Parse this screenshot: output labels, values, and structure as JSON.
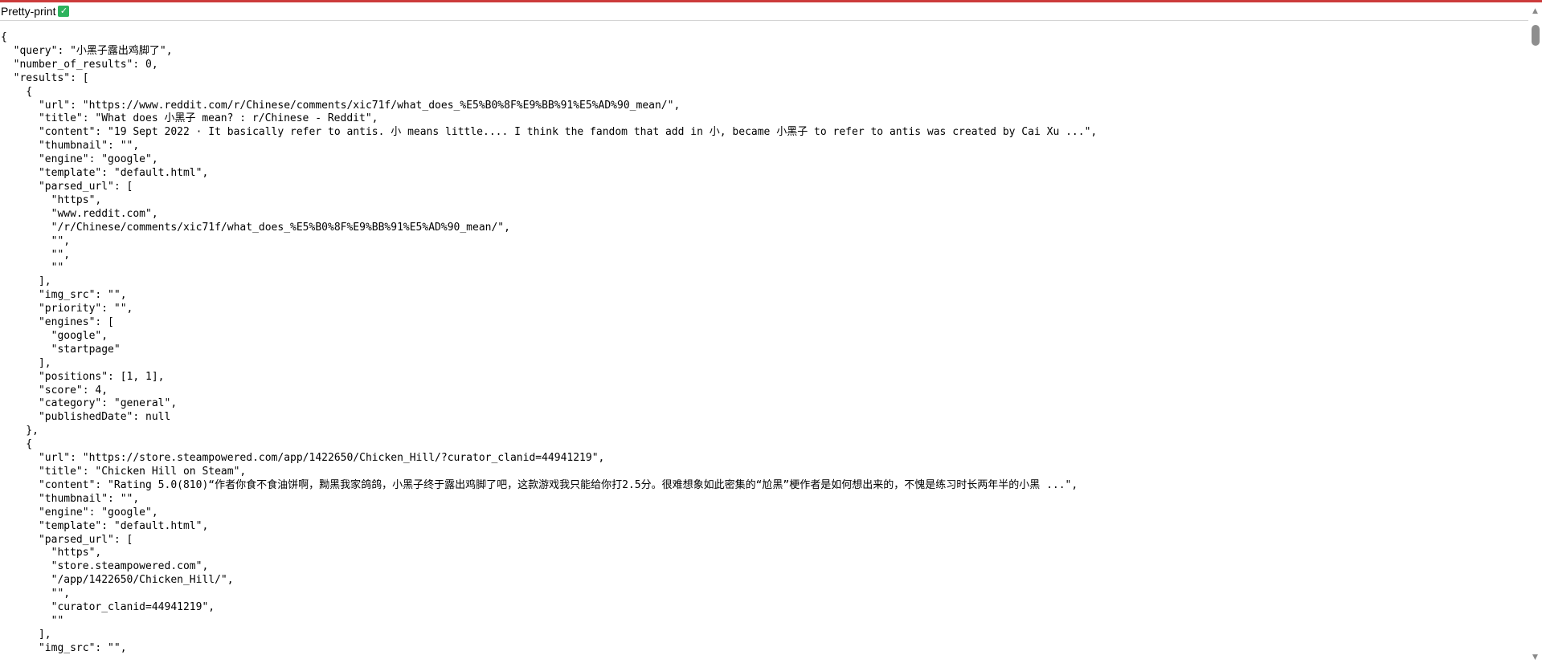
{
  "toolbar": {
    "pretty_print_label": "Pretty-print",
    "pretty_print_icon": "checkbox-checked-icon",
    "pretty_print_checked": true,
    "check_glyph": "✓"
  },
  "scrollbar": {
    "up_glyph": "▲",
    "down_glyph": "▼"
  },
  "json_lines": [
    "{",
    "  \"query\": \"小黑子露出鸡脚了\",",
    "  \"number_of_results\": 0,",
    "  \"results\": [",
    "    {",
    "      \"url\": \"https://www.reddit.com/r/Chinese/comments/xic71f/what_does_%E5%B0%8F%E9%BB%91%E5%AD%90_mean/\",",
    "      \"title\": \"What does 小黑子 mean? : r/Chinese - Reddit\",",
    "      \"content\": \"19 Sept 2022 · It basically refer to antis. 小 means little.... I think the fandom that add in 小, became 小黑子 to refer to antis was created by Cai Xu ...\",",
    "      \"thumbnail\": \"\",",
    "      \"engine\": \"google\",",
    "      \"template\": \"default.html\",",
    "      \"parsed_url\": [",
    "        \"https\",",
    "        \"www.reddit.com\",",
    "        \"/r/Chinese/comments/xic71f/what_does_%E5%B0%8F%E9%BB%91%E5%AD%90_mean/\",",
    "        \"\",",
    "        \"\",",
    "        \"\"",
    "      ],",
    "      \"img_src\": \"\",",
    "      \"priority\": \"\",",
    "      \"engines\": [",
    "        \"google\",",
    "        \"startpage\"",
    "      ],",
    "      \"positions\": [1, 1],",
    "      \"score\": 4,",
    "      \"category\": \"general\",",
    "      \"publishedDate\": null",
    "    },",
    "    {",
    "      \"url\": \"https://store.steampowered.com/app/1422650/Chicken_Hill/?curator_clanid=44941219\",",
    "      \"title\": \"Chicken Hill on Steam\",",
    "      \"content\": \"Rating 5.0(810)“作者你食不食油饼啊，黝黑我家鸽鸽，小黑子终于露出鸡脚了吧，这款游戏我只能给你打2.5分。很难想象如此密集的“尬黑”梗作者是如何想出来的，不愧是练习时长两年半的小黑 ...\",",
    "      \"thumbnail\": \"\",",
    "      \"engine\": \"google\",",
    "      \"template\": \"default.html\",",
    "      \"parsed_url\": [",
    "        \"https\",",
    "        \"store.steampowered.com\",",
    "        \"/app/1422650/Chicken_Hill/\",",
    "        \"\",",
    "        \"curator_clanid=44941219\",",
    "        \"\"",
    "      ],",
    "      \"img_src\": \"\","
  ]
}
